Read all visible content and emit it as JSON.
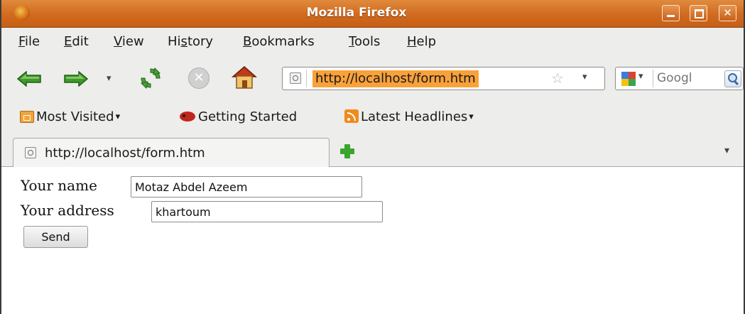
{
  "window": {
    "title": "Mozilla Firefox"
  },
  "menubar": {
    "items": [
      {
        "prefix": "",
        "accel": "F",
        "rest": "ile"
      },
      {
        "prefix": "",
        "accel": "E",
        "rest": "dit"
      },
      {
        "prefix": "",
        "accel": "V",
        "rest": "iew"
      },
      {
        "prefix": "Hi",
        "accel": "s",
        "rest": "tory"
      },
      {
        "prefix": "",
        "accel": "B",
        "rest": "ookmarks"
      },
      {
        "prefix": "",
        "accel": "T",
        "rest": "ools"
      },
      {
        "prefix": "",
        "accel": "H",
        "rest": "elp"
      }
    ]
  },
  "navbar": {
    "url": "http://localhost/form.htm",
    "search_placeholder": "Googl",
    "icons": [
      "back-arrow-icon",
      "forward-arrow-icon",
      "history-dropdown-icon",
      "reload-icon",
      "stop-icon",
      "home-icon",
      "bookmark-star-icon",
      "google-icon",
      "search-magnifier-icon"
    ]
  },
  "bookmarks": {
    "most_visited": "Most Visited",
    "getting_started": "Getting Started",
    "latest_headlines": "Latest Headlines"
  },
  "tabs": [
    {
      "label": "http://localhost/form.htm"
    }
  ],
  "form": {
    "name_label": "Your name",
    "name_value": "Motaz Abdel Azeem",
    "address_label": "Your address",
    "address_value": "khartoum",
    "submit_label": "Send"
  },
  "colors": {
    "titlebar": "#d06a1f",
    "url_highlight": "#f9a13a",
    "chrome_bg": "#ededeb"
  }
}
